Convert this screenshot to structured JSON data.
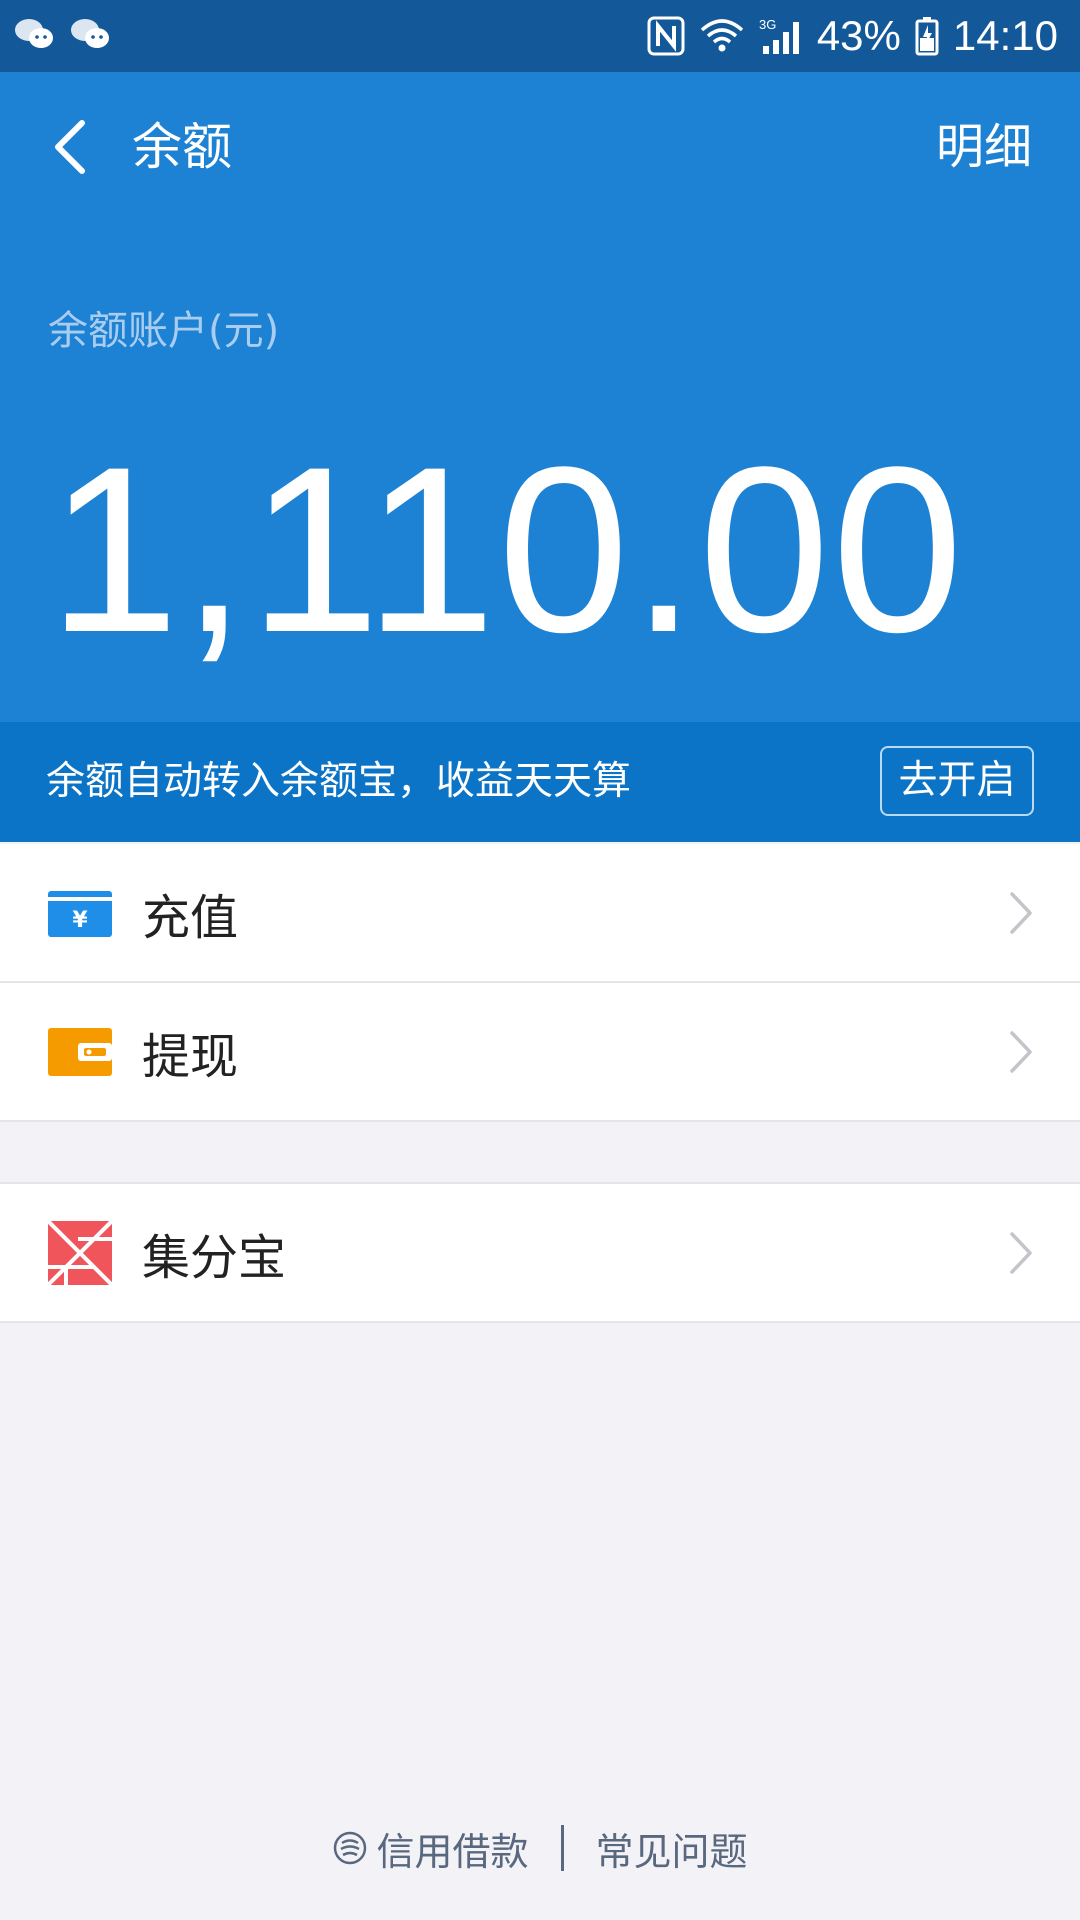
{
  "status_bar": {
    "battery": "43%",
    "time": "14:10",
    "network": "3G",
    "icons": [
      "wechat-icon",
      "wechat-icon",
      "nfc-icon",
      "wifi-icon",
      "signal-icon",
      "battery-icon"
    ]
  },
  "header": {
    "title": "余额",
    "detail_label": "明细",
    "account_label": "余额账户(元)",
    "balance": "1,110.00",
    "bg_color": "#1e82d4"
  },
  "promo": {
    "text": "余额自动转入余额宝，收益天天算",
    "button_label": "去开启"
  },
  "list_group_1": [
    {
      "label": "充值",
      "icon": "recharge-yuan-icon",
      "color": "#1e8ee8"
    },
    {
      "label": "提现",
      "icon": "wallet-icon",
      "color": "#f59b00"
    }
  ],
  "list_group_2": [
    {
      "label": "集分宝",
      "icon": "jifenbao-icon",
      "color": "#f0555c"
    }
  ],
  "footer": {
    "credit_link": "信用借款",
    "faq_link": "常见问题"
  }
}
